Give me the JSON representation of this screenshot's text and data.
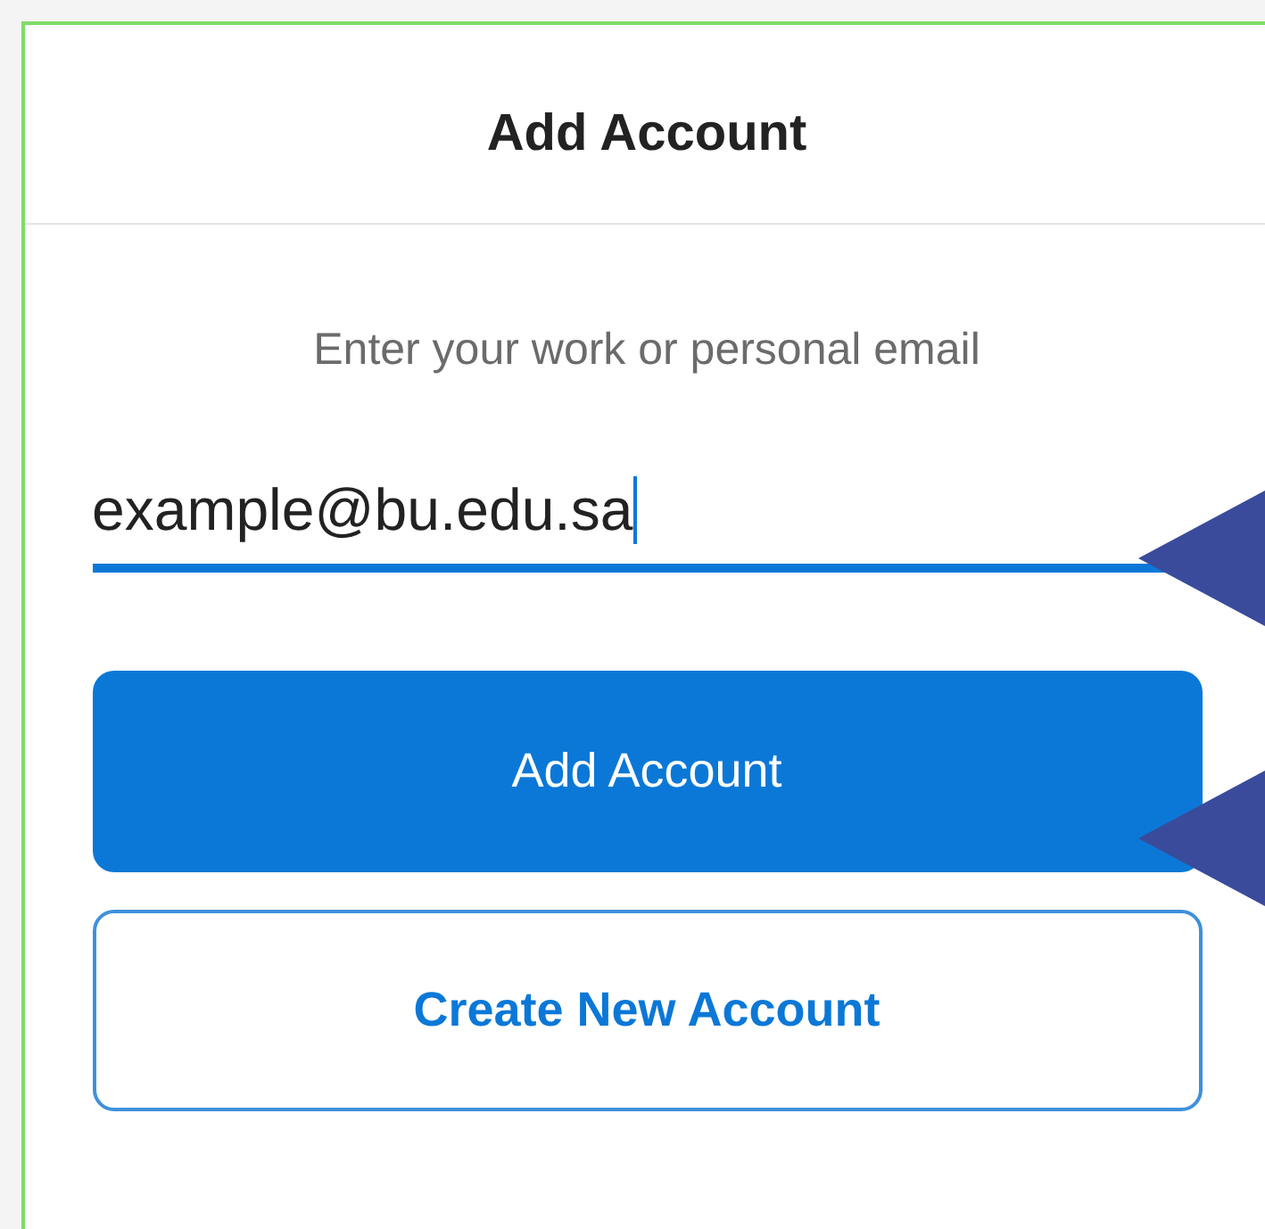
{
  "header": {
    "title": "Add Account"
  },
  "prompt": "Enter your work or personal email",
  "email_field": {
    "value": "example@bu.edu.sa",
    "focused": true
  },
  "buttons": [
    {
      "label": "Add Account",
      "kind": "primary"
    },
    {
      "label": "Create New Account",
      "kind": "outline"
    }
  ]
}
